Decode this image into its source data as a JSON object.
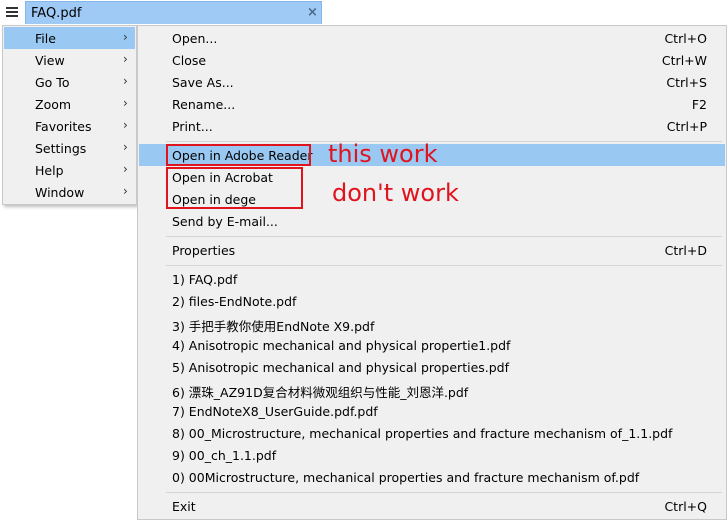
{
  "tab": {
    "title": "FAQ.pdf",
    "close": "×"
  },
  "main_menu": [
    {
      "label": "File",
      "active": true
    },
    {
      "label": "View"
    },
    {
      "label": "Go To"
    },
    {
      "label": "Zoom"
    },
    {
      "label": "Favorites"
    },
    {
      "label": "Settings"
    },
    {
      "label": "Help"
    },
    {
      "label": "Window"
    }
  ],
  "submenu_arrow": "›",
  "file_menu": {
    "open": {
      "label": "Open...",
      "shortcut": "Ctrl+O"
    },
    "close": {
      "label": "Close",
      "shortcut": "Ctrl+W"
    },
    "save_as": {
      "label": "Save As...",
      "shortcut": "Ctrl+S"
    },
    "rename": {
      "label": "Rename...",
      "shortcut": "F2"
    },
    "print": {
      "label": "Print...",
      "shortcut": "Ctrl+P"
    },
    "open_adobe_reader": {
      "label": "Open in Adobe Reader"
    },
    "open_acrobat": {
      "label": "Open in Acrobat"
    },
    "open_dege": {
      "label": "Open in dege"
    },
    "send_email": {
      "label": "Send by E-mail..."
    },
    "properties": {
      "label": "Properties",
      "shortcut": "Ctrl+D"
    },
    "recent": [
      "1) FAQ.pdf",
      "2) files-EndNote.pdf",
      "3) 手把手教你使用EndNote X9.pdf",
      "4) Anisotropic mechanical and physical propertie1.pdf",
      "5) Anisotropic mechanical and physical properties.pdf",
      "6) 漂珠_AZ91D复合材料微观组织与性能_刘恩洋.pdf",
      "7) EndNoteX8_UserGuide.pdf.pdf",
      "8) 00_Microstructure, mechanical properties and fracture mechanism of_1.1.pdf",
      "9) 00_ch_1.1.pdf",
      "0) 00Microstructure, mechanical properties and fracture mechanism of.pdf"
    ],
    "exit": {
      "label": "Exit",
      "shortcut": "Ctrl+Q"
    }
  },
  "annotations": {
    "works": "this work",
    "not_works": "don't work",
    "color": "#e0141e"
  },
  "colors": {
    "highlight": "#99c9f2",
    "tab": "#9fcaf5",
    "menu_bg": "#f0f0f0"
  }
}
